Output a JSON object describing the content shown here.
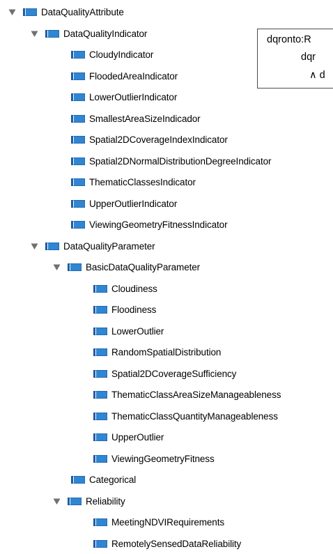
{
  "tree": [
    {
      "label": "DataQualityAttribute",
      "expanded": true,
      "icon": "class-icon",
      "children": [
        {
          "label": "DataQualityIndicator",
          "expanded": true,
          "icon": "class-icon",
          "children": [
            {
              "label": "CloudyIndicator",
              "icon": "class-icon"
            },
            {
              "label": "FloodedAreaIndicator",
              "icon": "class-icon"
            },
            {
              "label": "LowerOutlierIndicator",
              "icon": "class-icon"
            },
            {
              "label": "SmallestAreaSizeIndicador",
              "icon": "class-icon"
            },
            {
              "label": "Spatial2DCoverageIndexIndicator",
              "icon": "class-icon"
            },
            {
              "label": "Spatial2DNormalDistributionDegreeIndicator",
              "icon": "class-icon"
            },
            {
              "label": "ThematicClassesIndicator",
              "icon": "class-icon"
            },
            {
              "label": "UpperOutlierIndicator",
              "icon": "class-icon"
            },
            {
              "label": "ViewingGeometryFitnessIndicator",
              "icon": "class-icon"
            }
          ]
        },
        {
          "label": "DataQualityParameter",
          "expanded": true,
          "icon": "class-icon",
          "children": [
            {
              "label": "BasicDataQualityParameter",
              "expanded": true,
              "icon": "class-icon",
              "children": [
                {
                  "label": "Cloudiness",
                  "icon": "class-icon"
                },
                {
                  "label": "Floodiness",
                  "icon": "class-icon"
                },
                {
                  "label": "LowerOutlier",
                  "icon": "class-icon"
                },
                {
                  "label": "RandomSpatialDistribution",
                  "icon": "class-icon"
                },
                {
                  "label": "Spatial2DCoverageSufficiency",
                  "icon": "class-icon"
                },
                {
                  "label": "ThematicClassAreaSizeManageableness",
                  "icon": "class-icon"
                },
                {
                  "label": "ThematicClassQuantityManageableness",
                  "icon": "class-icon"
                },
                {
                  "label": "UpperOutlier",
                  "icon": "class-icon"
                },
                {
                  "label": "ViewingGeometryFitness",
                  "icon": "class-icon"
                }
              ]
            },
            {
              "label": "Categorical",
              "icon": "class-icon"
            },
            {
              "label": "Reliability",
              "expanded": true,
              "icon": "class-icon",
              "children": [
                {
                  "label": "MeetingNDVIRequirements",
                  "icon": "class-icon"
                },
                {
                  "label": "RemotelySensedDataReliability",
                  "icon": "class-icon"
                }
              ]
            }
          ]
        }
      ]
    }
  ],
  "tooltip": {
    "lines": [
      "dqronto:R",
      "dqr",
      "∧ d"
    ]
  },
  "colors": {
    "class_icon_dark": "#1b5fae",
    "class_icon_light": "#2f86d2",
    "toggle": "#707070"
  }
}
